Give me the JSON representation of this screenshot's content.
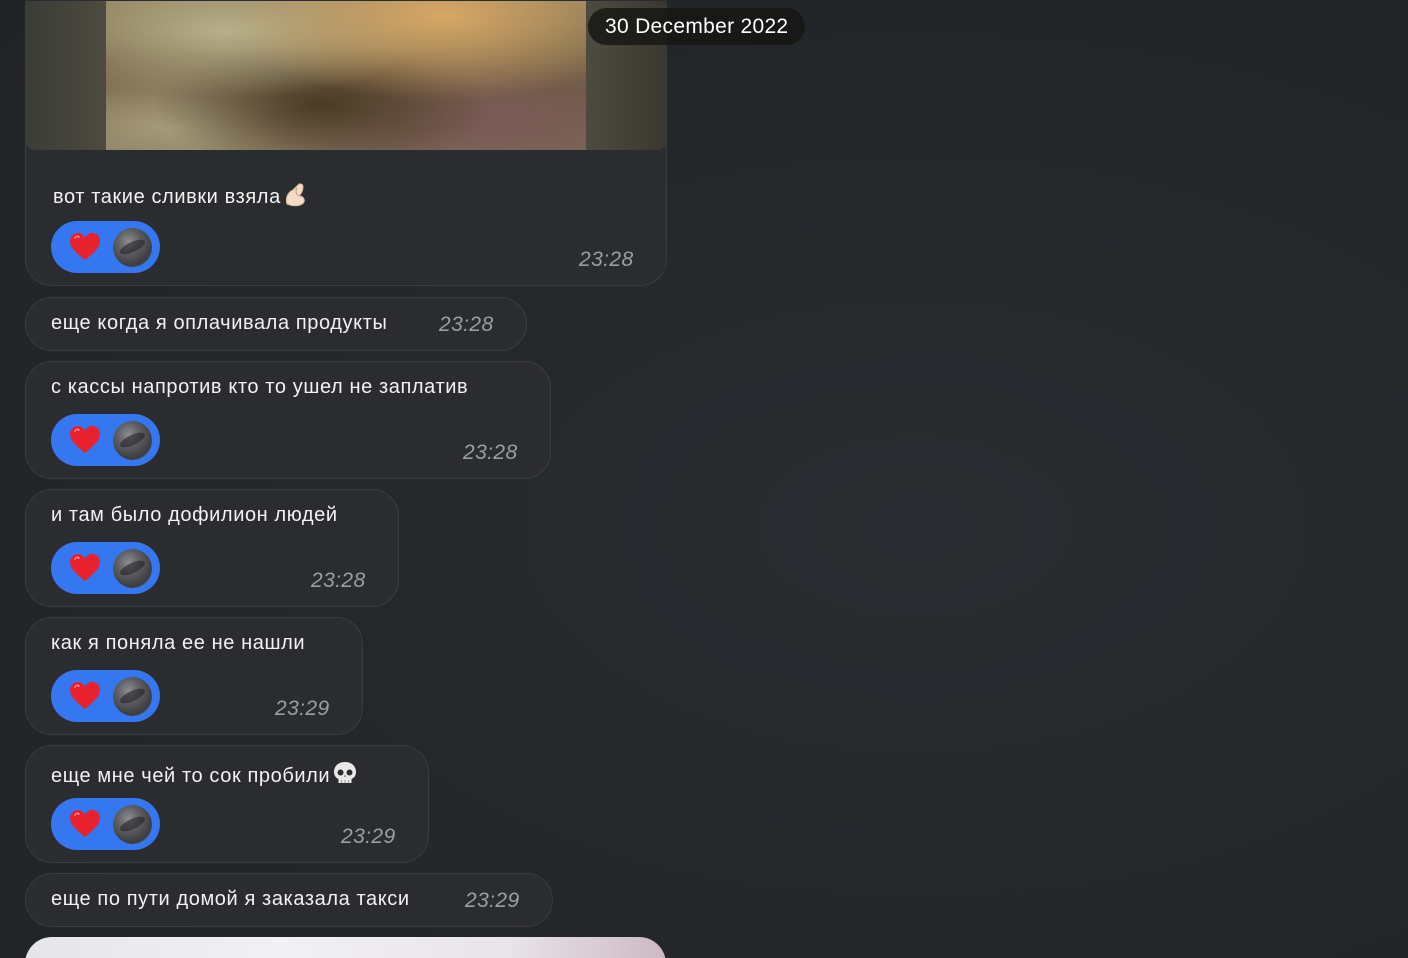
{
  "date_divider": "30 December 2022",
  "messages": [
    {
      "text": "вот такие сливки взяла",
      "emoji": "pinching-hand-icon",
      "time": "23:28",
      "reaction": "heart-icon",
      "has_photo": true
    },
    {
      "text": "еще когда я оплачивала продукты",
      "time": "23:28"
    },
    {
      "text": "с кассы напротив кто то ушел не заплатив",
      "time": "23:28",
      "reaction": "heart-icon"
    },
    {
      "text": "и там было дофилион людей",
      "time": "23:28",
      "reaction": "heart-icon"
    },
    {
      "text": "как я поняла ее не нашли",
      "time": "23:29",
      "reaction": "heart-icon"
    },
    {
      "text": "еще мне чей то сок пробили",
      "emoji": "skull-icon",
      "time": "23:29",
      "reaction": "heart-icon"
    },
    {
      "text": "еще по пути домой я заказала такси",
      "time": "23:29"
    }
  ],
  "colors": {
    "background": "#24272a",
    "bubble": "#2b2c2f",
    "reaction_pill": "#3477f0",
    "time_text": "#9a9ea6",
    "heart": "#e8212e"
  }
}
